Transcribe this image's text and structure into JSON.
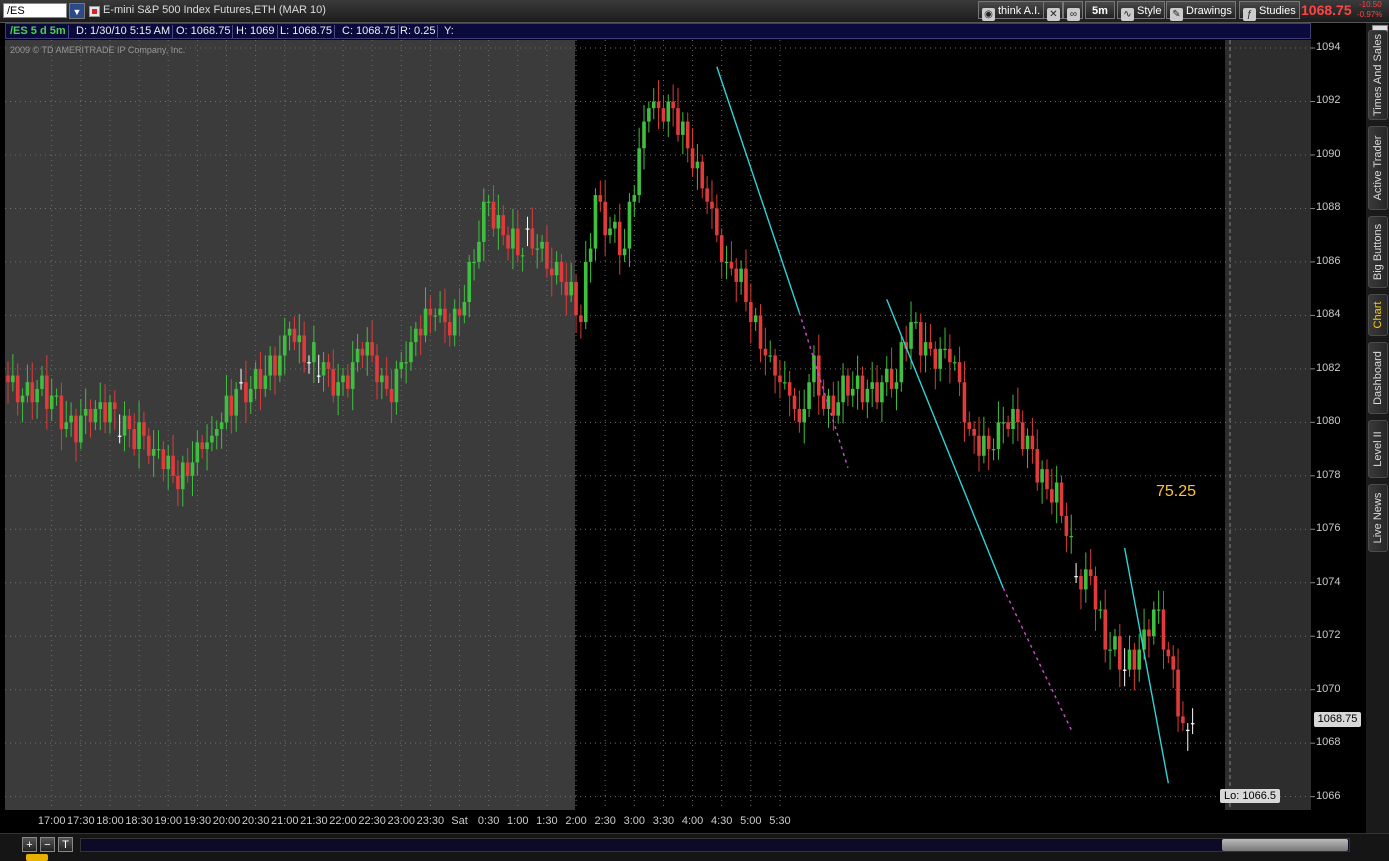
{
  "topbar": {
    "symbol": "/ES",
    "instrument": "E-mini S&P 500 Index Futures,ETH (MAR 10)",
    "buttons": {
      "think_ai": "think A.I.",
      "timeframe": "5m",
      "style": "Style",
      "drawings": "Drawings",
      "studies": "Studies"
    },
    "last_price": "1068.75",
    "net_change": "-10.50",
    "pct_change": "-0.97%",
    "price_color": "#ff4444"
  },
  "infobar": {
    "symbol": "/ES 5 d 5m",
    "date": "D: 1/30/10 5:15 AM",
    "open": "O: 1068.75",
    "high": "H: 1069",
    "low": "L: 1068.75",
    "close": "C: 1068.75",
    "range": "R: 0.25",
    "y": "Y:"
  },
  "copyright": "2009 © TD AMERITRADE IP Company, Inc.",
  "annotation": "75.25",
  "last_price_tag": "1068.75",
  "low_tag": "Lo: 1066.5",
  "side_tabs": [
    "Times And Sales",
    "Active Trader",
    "Big Buttons",
    "Chart",
    "Dashboard",
    "Level II",
    "Live News"
  ],
  "active_tab": "Chart",
  "colors": {
    "up": "#3fbf3f",
    "down": "#e03a3a",
    "doji": "#ffffff",
    "trendline": "#2fd3d8",
    "projection": "#d44ad4",
    "annotation": "#ffc72e"
  },
  "chart_data": {
    "type": "candlestick",
    "y_ticks": [
      "1094",
      "1092",
      "1090",
      "1088",
      "1086",
      "1084",
      "1082",
      "1080",
      "1078",
      "1076",
      "1074",
      "1072",
      "1070",
      "1068",
      "1066"
    ],
    "ylim": [
      1065.5,
      1094.3
    ],
    "x_ticks": [
      "17:00",
      "17:30",
      "18:00",
      "18:30",
      "19:00",
      "19:30",
      "20:00",
      "20:30",
      "21:00",
      "21:30",
      "22:00",
      "22:30",
      "23:00",
      "23:30",
      "Sat",
      "0:30",
      "1:00",
      "1:30",
      "2:00",
      "2:30",
      "3:00",
      "3:30",
      "4:00",
      "4:30",
      "5:00",
      "5:30"
    ],
    "session_split_index": 114,
    "anchors": [
      [
        0,
        1081.5
      ],
      [
        6,
        1081.2
      ],
      [
        12,
        1080.1
      ],
      [
        18,
        1080.4
      ],
      [
        24,
        1080.2
      ],
      [
        30,
        1078.9
      ],
      [
        34,
        1078.1
      ],
      [
        38,
        1078.4
      ],
      [
        42,
        1079.6
      ],
      [
        47,
        1081.3
      ],
      [
        52,
        1081.2
      ],
      [
        58,
        1083.4
      ],
      [
        62,
        1082.3
      ],
      [
        68,
        1081.5
      ],
      [
        73,
        1082.6
      ],
      [
        78,
        1081.3
      ],
      [
        83,
        1083.1
      ],
      [
        88,
        1084.0
      ],
      [
        93,
        1084.0
      ],
      [
        96,
        1086.0
      ],
      [
        99,
        1088.3
      ],
      [
        102,
        1087.1
      ],
      [
        106,
        1086.3
      ],
      [
        110,
        1086.7
      ],
      [
        114,
        1085.3
      ],
      [
        118,
        1083.8
      ],
      [
        121,
        1088.4
      ],
      [
        127,
        1086.6
      ],
      [
        132,
        1091.8
      ],
      [
        136,
        1092.0
      ],
      [
        140,
        1090.2
      ],
      [
        144,
        1088.3
      ],
      [
        148,
        1086.0
      ],
      [
        152,
        1084.6
      ],
      [
        156,
        1082.6
      ],
      [
        160,
        1081.6
      ],
      [
        163,
        1079.9
      ],
      [
        166,
        1082.6
      ],
      [
        168,
        1080.6
      ],
      [
        171,
        1080.7
      ],
      [
        174,
        1081.3
      ],
      [
        177,
        1081.2
      ],
      [
        180,
        1081.5
      ],
      [
        183,
        1081.6
      ],
      [
        186,
        1083.8
      ],
      [
        190,
        1082.8
      ],
      [
        194,
        1082.3
      ],
      [
        198,
        1079.8
      ],
      [
        203,
        1079.0
      ],
      [
        207,
        1080.4
      ],
      [
        211,
        1078.9
      ],
      [
        214,
        1077.4
      ],
      [
        217,
        1076.6
      ],
      [
        220,
        1074.3
      ],
      [
        223,
        1074.2
      ],
      [
        226,
        1071.5
      ],
      [
        230,
        1070.8
      ],
      [
        233,
        1071.6
      ],
      [
        236,
        1072.9
      ],
      [
        239,
        1071.2
      ],
      [
        241,
        1069.1
      ],
      [
        243,
        1068.5
      ],
      [
        244,
        1068.75
      ]
    ],
    "doji_indices": [
      23,
      48,
      62,
      64,
      107,
      220,
      230,
      243,
      244
    ],
    "trendlines": [
      {
        "from": [
          146,
          1093.3
        ],
        "to": [
          163,
          1084.1
        ]
      },
      {
        "from": [
          181,
          1084.6
        ],
        "to": [
          205,
          1073.8
        ]
      },
      {
        "from": [
          230,
          1075.3
        ],
        "to": [
          239,
          1066.5
        ]
      }
    ],
    "projections": [
      {
        "from": [
          163,
          1084.1
        ],
        "to": [
          173,
          1078.3
        ]
      },
      {
        "from": [
          205,
          1073.8
        ],
        "to": [
          219,
          1068.5
        ]
      }
    ],
    "last_price": 1068.75,
    "low": 1066.5
  }
}
